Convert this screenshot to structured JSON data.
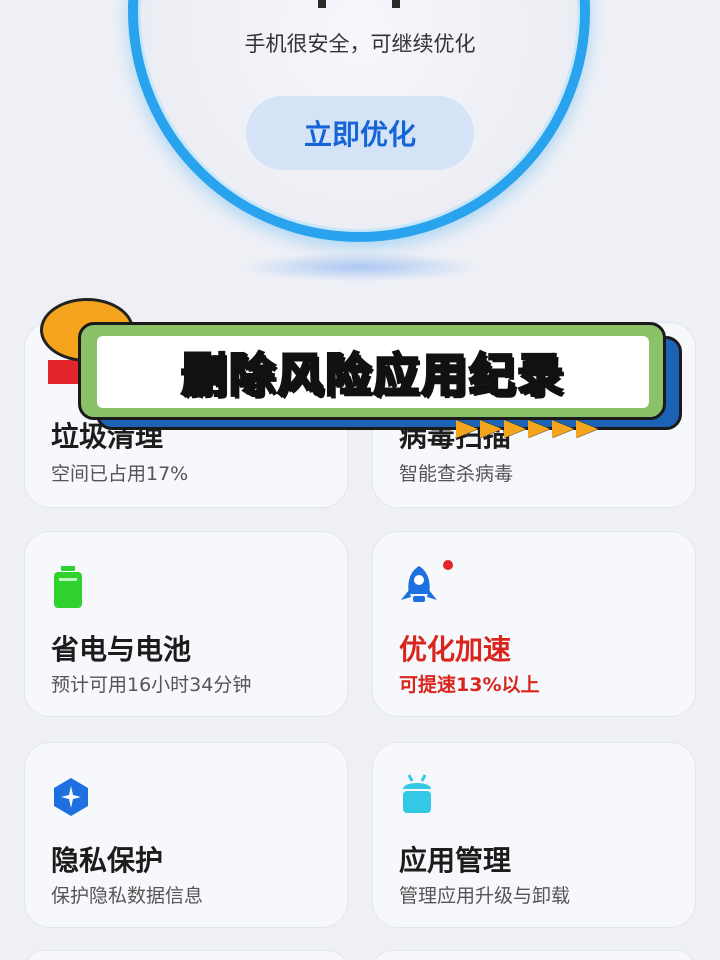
{
  "status": {
    "message": "手机很安全，可继续优化",
    "optimize_button": "立即优化"
  },
  "banner": {
    "text": "删除风险应用纪录"
  },
  "cards": [
    {
      "title": "垃圾清理",
      "subtitle": "空间已占用17%",
      "icon": "trash-icon",
      "color": "#e3262b"
    },
    {
      "title": "病毒扫描",
      "subtitle": "智能查杀病毒",
      "icon": "virus-scan-icon",
      "color": "#1c63b5"
    },
    {
      "title": "省电与电池",
      "subtitle": "预计可用16小时34分钟",
      "icon": "battery-icon",
      "color": "#2fd12f"
    },
    {
      "title": "优化加速",
      "subtitle": "可提速13%以上",
      "icon": "rocket-icon",
      "color": "#1e6fe0",
      "alert_color": "#d9251c"
    },
    {
      "title": "隐私保护",
      "subtitle": "保护隐私数据信息",
      "icon": "privacy-shield-icon",
      "color": "#1e6fe0"
    },
    {
      "title": "应用管理",
      "subtitle": "管理应用升级与卸载",
      "icon": "android-app-icon",
      "color": "#32c8e6"
    }
  ]
}
